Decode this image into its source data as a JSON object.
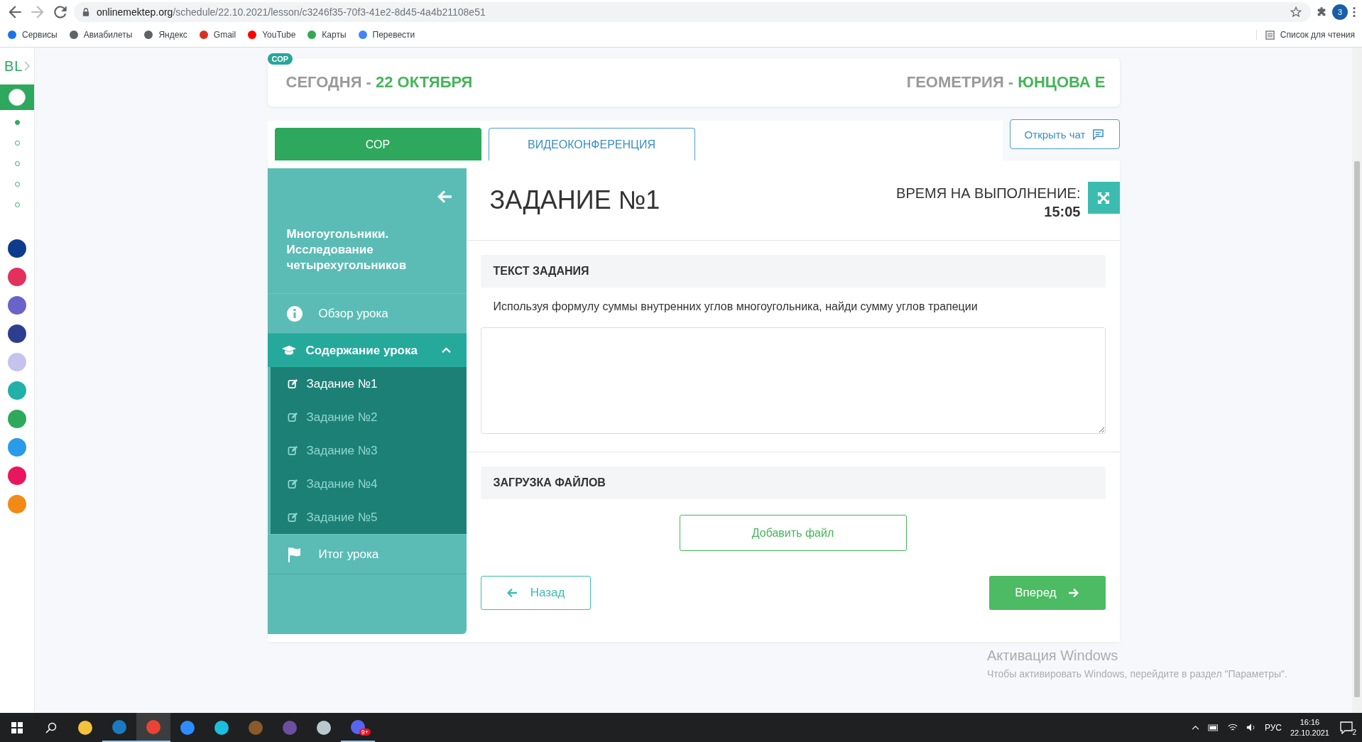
{
  "browser": {
    "url_host": "onlinemektep.org",
    "url_path": "/schedule/22.10.2021/lesson/c3246f35-70f3-41e2-8d45-4a4b21108e51",
    "profile": "3",
    "bookmarks": [
      "Сервисы",
      "Авиабилеты",
      "Яндекс",
      "Gmail",
      "YouTube",
      "Карты",
      "Перевести"
    ],
    "reading_list": "Список для чтения"
  },
  "rail": {
    "logo": "BL",
    "active_app": true,
    "pages": [
      {
        "selected": true
      },
      {
        "selected": false
      },
      {
        "selected": false
      },
      {
        "selected": false
      },
      {
        "selected": false
      }
    ],
    "apps": [
      {
        "color": "#0e3c8c"
      },
      {
        "color": "#e2315f"
      },
      {
        "color": "#6a63c9"
      },
      {
        "color": "#2d3e8f"
      },
      {
        "color": "#c6c2ee"
      },
      {
        "color": "#21b1a8"
      },
      {
        "color": "#2ea85c"
      },
      {
        "color": "#2a9be6"
      },
      {
        "color": "#e8175d"
      },
      {
        "color": "#f28a15"
      }
    ]
  },
  "header": {
    "badge": "СОР",
    "today_label": "СЕГОДНЯ - ",
    "date": "22 ОКТЯБРЯ",
    "subject": "ГЕОМЕТРИЯ - ",
    "teacher": "ЮНЦОВА Е"
  },
  "tabs": [
    {
      "label": "СОР",
      "selected": true
    },
    {
      "label": "ВИДЕОКОНФЕРЕНЦИЯ",
      "selected": false
    }
  ],
  "chat_button": "Открыть чат",
  "lesson_nav": {
    "title": "Многоугольники. Исследование четырехугольников",
    "items": [
      {
        "kind": "link",
        "label": "Обзор урока"
      },
      {
        "kind": "group",
        "label": "Содержание урока",
        "expanded": true,
        "children": [
          {
            "label": "Задание №1",
            "selected": true
          },
          {
            "label": "Задание №2",
            "selected": false
          },
          {
            "label": "Задание №3",
            "selected": false
          },
          {
            "label": "Задание №4",
            "selected": false
          },
          {
            "label": "Задание №5",
            "selected": false
          }
        ]
      },
      {
        "kind": "link",
        "label": "Итог урока"
      }
    ]
  },
  "task": {
    "title": "ЗАДАНИЕ №1",
    "timer_label": "ВРЕМЯ НА ВЫПОЛНЕНИЕ:",
    "timer": "15:05",
    "text_heading": "ТЕКСТ ЗАДАНИЯ",
    "text": "Используя формулу суммы внутренних углов многоугольника, найди сумму углов трапеции",
    "upload_heading": "ЗАГРУЗКА ФАЙЛОВ",
    "add_file": "Добавить файл",
    "back": "Назад",
    "next": "Вперед"
  },
  "activation": {
    "title": "Активация Windows",
    "text": "Чтобы активировать Windows, перейдите в раздел \"Параметры\"."
  },
  "taskbar": {
    "apps": [
      {
        "running": false,
        "selected": false
      },
      {
        "running": true,
        "selected": false
      },
      {
        "running": true,
        "selected": true
      },
      {
        "running": false,
        "selected": false
      },
      {
        "running": false,
        "selected": false
      },
      {
        "running": false,
        "selected": false
      },
      {
        "running": false,
        "selected": false
      },
      {
        "running": false,
        "selected": false
      },
      {
        "running": true,
        "selected": false,
        "badge": "9+"
      }
    ],
    "language": "РУС",
    "time": "16:16",
    "date": "22.10.2021",
    "notifications": "2"
  }
}
